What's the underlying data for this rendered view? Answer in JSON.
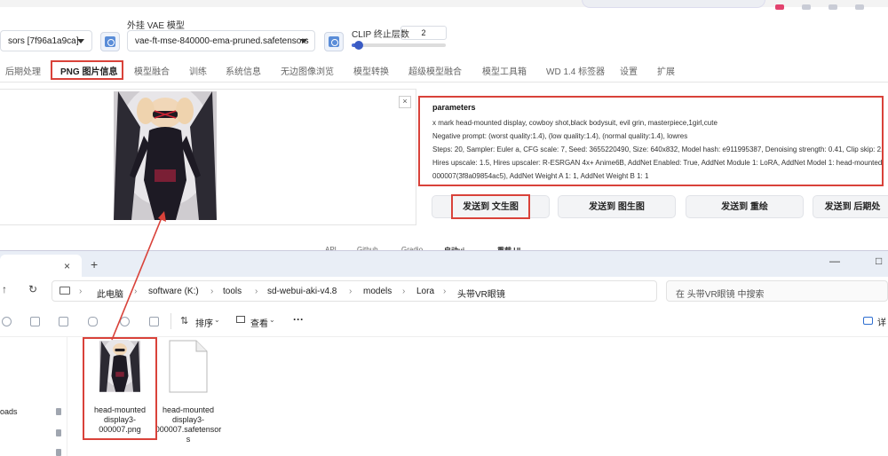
{
  "browser": {
    "url": "http://127.0.0.1:7860"
  },
  "webui": {
    "checkpoint_value": "sors [7f96a1a9ca]",
    "vae_label": "外挂 VAE 模型",
    "vae_value": "vae-ft-mse-840000-ema-pruned.safetensors",
    "clip_label": "CLIP 终止层数",
    "clip_value": "2",
    "clip_fraction": 0.08,
    "tabs": [
      {
        "label": "后期处理",
        "active": false
      },
      {
        "label": "PNG 图片信息",
        "active": true
      },
      {
        "label": "模型融合",
        "active": false
      },
      {
        "label": "训练",
        "active": false
      },
      {
        "label": "系统信息",
        "active": false
      },
      {
        "label": "无边图像浏览",
        "active": false
      },
      {
        "label": "模型转换",
        "active": false
      },
      {
        "label": "超级模型融合",
        "active": false
      },
      {
        "label": "模型工具箱",
        "active": false
      },
      {
        "label": "WD 1.4 标签器",
        "active": false
      },
      {
        "label": "设置",
        "active": false
      },
      {
        "label": "扩展",
        "active": false
      }
    ],
    "close_label": "×",
    "params": {
      "title": "parameters",
      "lines": [
        "x mark head-mounted display, cowboy shot,black bodysuit, evil grin, masterpiece,1girl,cute",
        "Negative prompt: (worst quality:1.4), (low quality:1.4), (normal quality:1.4), lowres",
        "Steps: 20, Sampler: Euler a, CFG scale: 7, Seed: 3655220490, Size: 640x832, Model hash: e911995387, Denoising strength: 0.41, Clip skip: 2, EN",
        "Hires upscale: 1.5, Hires upscaler: R-ESRGAN 4x+ Anime6B, AddNet Enabled: True, AddNet Module 1: LoRA, AddNet Model 1: head-mounted d",
        "000007(3f8a09854ac5), AddNet Weight A 1: 1, AddNet Weight B 1: 1"
      ]
    },
    "send_buttons": [
      "发送到 文生图",
      "发送到 图生图",
      "发送到 重绘",
      "发送到 后期处"
    ],
    "footer": [
      "API",
      "Github",
      "Gradio",
      "启动ui",
      "重载 UI"
    ]
  },
  "explorer": {
    "tab_close": "×",
    "new_tab": "+",
    "window_controls": [
      "—",
      "□"
    ],
    "path": [
      "此电脑",
      "software (K:)",
      "tools",
      "sd-webui-aki-v4.8",
      "models",
      "Lora",
      "头带VR眼镜"
    ],
    "search_placeholder": "在 头带VR眼镜 中搜索",
    "toolbar": {
      "sort_label": "排序",
      "view_label": "查看",
      "more_label": "···",
      "details_label": "详"
    },
    "sidebar_items": [
      "oads"
    ],
    "files": [
      {
        "name": "head-mounted display3-000007.png",
        "type": "image"
      },
      {
        "name": "head-mounted display3-000007.safetensors",
        "type": "document"
      }
    ]
  },
  "colors": {
    "annotation": "#d9423a",
    "accent": "#5a8dd8"
  }
}
